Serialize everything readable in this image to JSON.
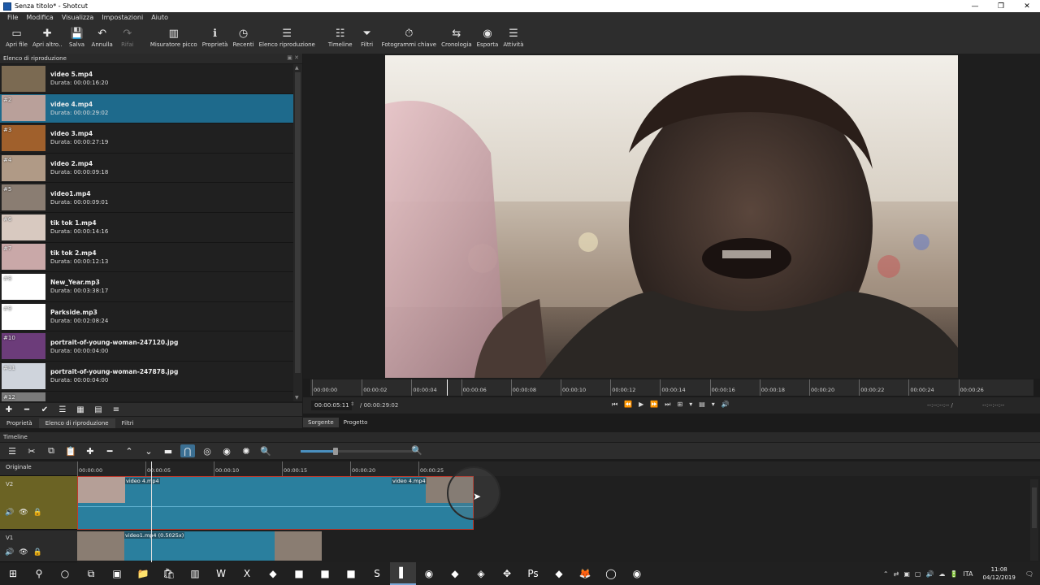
{
  "window": {
    "title": "Senza titolo* - Shotcut",
    "min": "—",
    "max": "❐",
    "close": "✕"
  },
  "menu": [
    "File",
    "Modifica",
    "Visualizza",
    "Impostazioni",
    "Aiuto"
  ],
  "toolbar": [
    {
      "label": "Apri file",
      "icon": "open-file-icon",
      "glyph": "▭",
      "disabled": false
    },
    {
      "label": "Apri altro..",
      "icon": "open-other-icon",
      "glyph": "✚",
      "disabled": false
    },
    {
      "label": "Salva",
      "icon": "save-icon",
      "glyph": "💾",
      "disabled": false
    },
    {
      "label": "Annulla",
      "icon": "undo-icon",
      "glyph": "↶",
      "disabled": false
    },
    {
      "label": "Rifai",
      "icon": "redo-icon",
      "glyph": "↷",
      "disabled": true
    },
    {
      "label": "Misuratore picco",
      "icon": "peak-meter-icon",
      "glyph": "▥",
      "disabled": false
    },
    {
      "label": "Proprietà",
      "icon": "properties-icon",
      "glyph": "ℹ",
      "disabled": false
    },
    {
      "label": "Recenti",
      "icon": "recent-icon",
      "glyph": "◷",
      "disabled": false
    },
    {
      "label": "Elenco riproduzione",
      "icon": "playlist-icon",
      "glyph": "☰",
      "disabled": false
    },
    {
      "label": "Timeline",
      "icon": "timeline-icon",
      "glyph": "☷",
      "disabled": false
    },
    {
      "label": "Filtri",
      "icon": "filter-icon",
      "glyph": "⏷",
      "disabled": false
    },
    {
      "label": "Fotogrammi chiave",
      "icon": "keyframes-icon",
      "glyph": "⏱",
      "disabled": false
    },
    {
      "label": "Cronologia",
      "icon": "history-icon",
      "glyph": "⇆",
      "disabled": false
    },
    {
      "label": "Esporta",
      "icon": "export-icon",
      "glyph": "◉",
      "disabled": false
    },
    {
      "label": "Attività",
      "icon": "jobs-icon",
      "glyph": "☰",
      "disabled": false
    }
  ],
  "playlist": {
    "title": "Elenco di riproduzione",
    "dock_buttons": "▣ ✕",
    "items": [
      {
        "num": "",
        "name": "video 5.mp4",
        "duration": "Durata: 00:00:16:20",
        "thumb": "#7b6a52"
      },
      {
        "num": "#2",
        "name": "video 4.mp4",
        "duration": "Durata: 00:00:29:02",
        "thumb": "#b9a09a",
        "selected": true
      },
      {
        "num": "#3",
        "name": "video 3.mp4",
        "duration": "Durata: 00:00:27:19",
        "thumb": "#a0602c"
      },
      {
        "num": "#4",
        "name": "video 2.mp4",
        "duration": "Durata: 00:00:09:18",
        "thumb": "#b09a86"
      },
      {
        "num": "#5",
        "name": "video1.mp4",
        "duration": "Durata: 00:00:09:01",
        "thumb": "#8a7d72"
      },
      {
        "num": "#6",
        "name": "tik tok 1.mp4",
        "duration": "Durata: 00:00:14:16",
        "thumb": "#d8c9c0"
      },
      {
        "num": "#7",
        "name": "tik tok 2.mp4",
        "duration": "Durata: 00:00:12:13",
        "thumb": "#c9a8a8"
      },
      {
        "num": "#8",
        "name": "New_Year.mp3",
        "duration": "Durata: 00:03:38:17",
        "thumb": "#ffffff"
      },
      {
        "num": "#9",
        "name": "Parkside.mp3",
        "duration": "Durata: 00:02:08:24",
        "thumb": "#ffffff"
      },
      {
        "num": "#10",
        "name": "portrait-of-young-woman-247120.jpg",
        "duration": "Durata: 00:00:04:00",
        "thumb": "#6c3c7a"
      },
      {
        "num": "#11",
        "name": "portrait-of-young-woman-247878.jpg",
        "duration": "Durata: 00:00:04:00",
        "thumb": "#cfd4dc"
      },
      {
        "num": "#12",
        "name": "",
        "duration": "",
        "thumb": "#7b7b7b"
      }
    ],
    "tools": [
      "✚",
      "━",
      "✔",
      "☰",
      "▦",
      "▤",
      "≡"
    ],
    "tabs": [
      "Proprietà",
      "Elenco di riproduzione",
      "Filtri"
    ]
  },
  "viewer": {
    "ruler_ticks": [
      "00:00:00",
      "00:00:02",
      "00:00:04",
      "00:00:06",
      "00:00:08",
      "00:00:10",
      "00:00:12",
      "00:00:14",
      "00:00:16",
      "00:00:18",
      "00:00:20",
      "00:00:22",
      "00:00:24",
      "00:00:26"
    ],
    "ruler_playhead_seconds": 5.44,
    "timecode": "00:00:05:11",
    "total": "/ 00:00:29:02",
    "in_point": "--:--:--:-- /",
    "out_point": "--:--:--:--",
    "controls": [
      "⏮",
      "⏪",
      "▶",
      "⏩",
      "⏭",
      "⊞",
      "▾",
      "▤",
      "▾",
      "🔊"
    ],
    "tabs": [
      "Sorgente",
      "Progetto"
    ]
  },
  "timeline": {
    "title": "Timeline",
    "tools": [
      "☰",
      "✂",
      "⧉",
      "📋",
      "✚",
      "━",
      "⌃",
      "⌄",
      "▬",
      "⋂",
      "◎",
      "◉",
      "✺",
      "🔍"
    ],
    "zoom_in": "🔍",
    "ruler_ticks": [
      "00:00:00",
      "00:00:05",
      "00:00:10",
      "00:00:15",
      "00:00:20",
      "00:00:25"
    ],
    "playhead_seconds": 5.44,
    "tracks": [
      {
        "name": "Originale"
      },
      {
        "name": "V2",
        "clip_labels": [
          "video 4.mp4",
          "video 4.mp4"
        ]
      },
      {
        "name": "V1",
        "clip_labels": [
          "video1.mp4 (0.5025x)"
        ]
      }
    ],
    "track_icons": [
      "🔊",
      "👁",
      "🔒"
    ]
  },
  "taskbar": {
    "apps": [
      "⊞",
      "⚲",
      "○",
      "⧉",
      "▣",
      "📁",
      "🛍",
      "▥",
      "W",
      "X",
      "◆",
      "■",
      "■",
      "■",
      "S",
      "▌",
      "◉",
      "◆",
      "◈",
      "✥",
      "Ps",
      "◆",
      "🦊",
      "◯",
      "◉"
    ],
    "tray": [
      "⌃",
      "⇄",
      "▣",
      "▢",
      "🔊",
      "☁",
      "🔋"
    ],
    "lang": "ITA",
    "time": "11:08",
    "date": "04/12/2019",
    "notif": "🗨"
  }
}
